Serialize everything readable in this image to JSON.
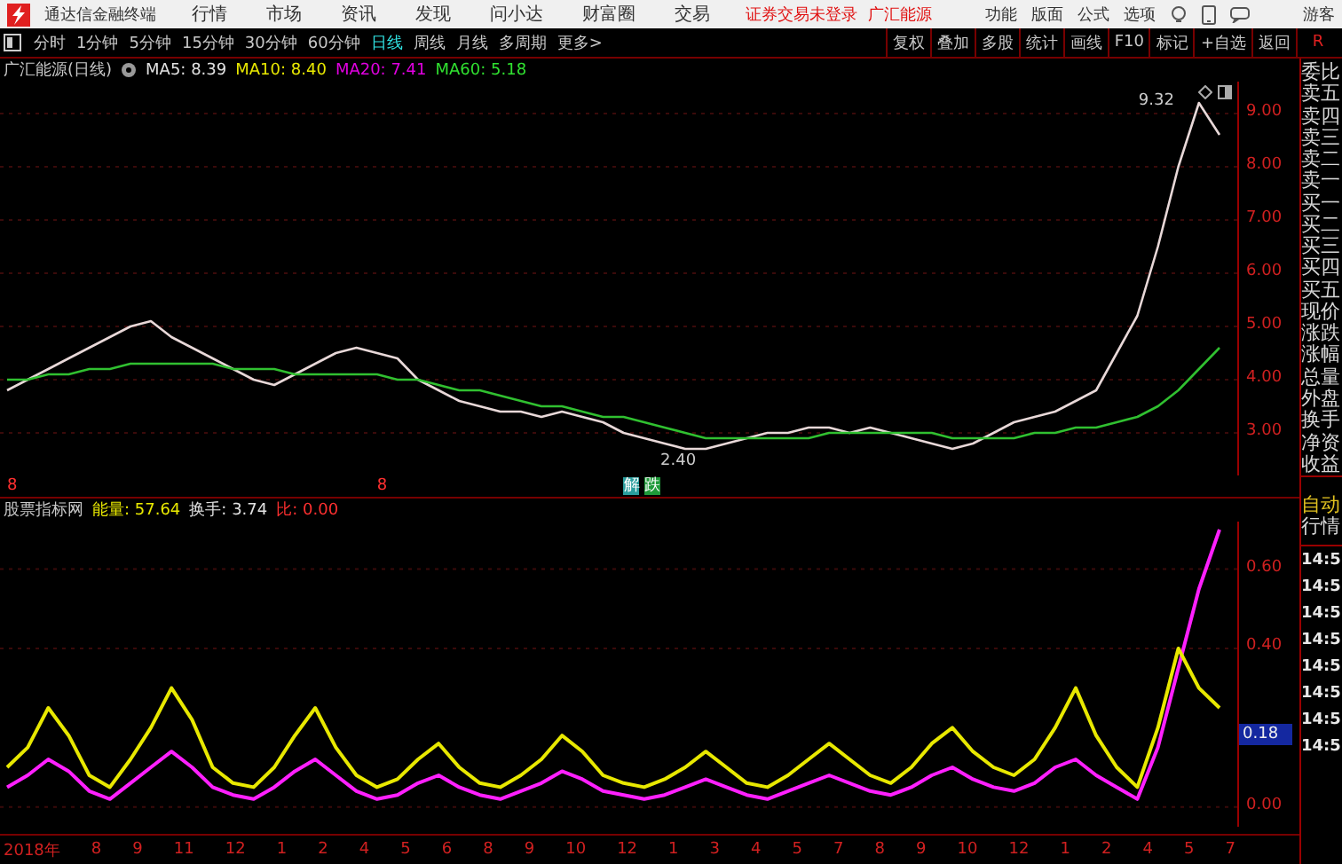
{
  "app": {
    "name": "通达信金融终端",
    "menu": [
      "行情",
      "市场",
      "资讯",
      "发现",
      "问小达",
      "财富圈",
      "交易"
    ],
    "login_notice": "证券交易未登录",
    "stock_link": "广汇能源",
    "tools": [
      "功能",
      "版面",
      "公式",
      "选项"
    ],
    "user": "游客"
  },
  "periods": [
    {
      "label": "分时",
      "selected": false
    },
    {
      "label": "1分钟",
      "selected": false
    },
    {
      "label": "5分钟",
      "selected": false
    },
    {
      "label": "15分钟",
      "selected": false
    },
    {
      "label": "30分钟",
      "selected": false
    },
    {
      "label": "60分钟",
      "selected": false
    },
    {
      "label": "日线",
      "selected": true
    },
    {
      "label": "周线",
      "selected": false
    },
    {
      "label": "月线",
      "selected": false
    },
    {
      "label": "多周期",
      "selected": false
    },
    {
      "label": "更多>",
      "selected": false
    }
  ],
  "chart_buttons": [
    "复权",
    "叠加",
    "多股",
    "统计",
    "画线",
    "F10",
    "标记",
    "+自选",
    "返回"
  ],
  "panel_toggle": "R",
  "price_header": {
    "title": "广汇能源(日线)",
    "ma": [
      {
        "label": "MA5: 8.39",
        "color": "#e0e0e0"
      },
      {
        "label": "MA10: 8.40",
        "color": "#e8e800"
      },
      {
        "label": "MA20: 7.41",
        "color": "#e000e0"
      },
      {
        "label": "MA60: 5.18",
        "color": "#30e030"
      }
    ]
  },
  "price_chart": {
    "chart_data": {
      "type": "line",
      "grid": true,
      "ylim": [
        2.2,
        9.6
      ],
      "yticks": [
        {
          "value": 3,
          "label": "3.00"
        },
        {
          "value": 4,
          "label": "4.00"
        },
        {
          "value": 5,
          "label": "5.00"
        },
        {
          "value": 6,
          "label": "6.00"
        },
        {
          "value": 7,
          "label": "7.00"
        },
        {
          "value": 8,
          "label": "8.00"
        },
        {
          "value": 9,
          "label": "9.00"
        }
      ],
      "series": [
        {
          "color": "#e8d8d8",
          "values": [
            3.8,
            4.0,
            4.2,
            4.4,
            4.6,
            4.8,
            5.0,
            5.1,
            4.8,
            4.6,
            4.4,
            4.2,
            4.0,
            3.9,
            4.1,
            4.3,
            4.5,
            4.6,
            4.5,
            4.4,
            4.0,
            3.8,
            3.6,
            3.5,
            3.4,
            3.4,
            3.3,
            3.4,
            3.3,
            3.2,
            3.0,
            2.9,
            2.8,
            2.7,
            2.7,
            2.8,
            2.9,
            3.0,
            3.0,
            3.1,
            3.1,
            3.0,
            3.1,
            3.0,
            2.9,
            2.8,
            2.7,
            2.8,
            3.0,
            3.2,
            3.3,
            3.4,
            3.6,
            3.8,
            4.5,
            5.2,
            6.5,
            8.0,
            9.2,
            8.6
          ]
        },
        {
          "color": "#30c030",
          "values": [
            4.0,
            4.0,
            4.1,
            4.1,
            4.2,
            4.2,
            4.3,
            4.3,
            4.3,
            4.3,
            4.3,
            4.2,
            4.2,
            4.2,
            4.1,
            4.1,
            4.1,
            4.1,
            4.1,
            4.0,
            4.0,
            3.9,
            3.8,
            3.8,
            3.7,
            3.6,
            3.5,
            3.5,
            3.4,
            3.3,
            3.3,
            3.2,
            3.1,
            3.0,
            2.9,
            2.9,
            2.9,
            2.9,
            2.9,
            2.9,
            3.0,
            3.0,
            3.0,
            3.0,
            3.0,
            3.0,
            2.9,
            2.9,
            2.9,
            2.9,
            3.0,
            3.0,
            3.1,
            3.1,
            3.2,
            3.3,
            3.5,
            3.8,
            4.2,
            4.6
          ]
        }
      ]
    }
  },
  "extreme_labels": {
    "high": "9.32",
    "low": "2.40"
  },
  "event_marks": [
    {
      "text": "8",
      "color": "#ff3030"
    },
    {
      "text": "8",
      "color": "#ff3030"
    },
    {
      "text": "解",
      "color": "#2a9d9d"
    },
    {
      "text": "跌",
      "color": "#1f9a3a"
    }
  ],
  "indicator": {
    "title": "股票指标网",
    "values": [
      {
        "label": "能量: 57.64",
        "color": "#e8e800"
      },
      {
        "label": "换手: 3.74",
        "color": "#e0e0e0"
      },
      {
        "label": "比: 0.00",
        "color": "#ff3030"
      }
    ],
    "current": "0.18",
    "chart_data": {
      "type": "line",
      "grid": true,
      "ylim": [
        -0.05,
        0.72
      ],
      "yticks": [
        {
          "value": 0,
          "label": "0.00"
        },
        {
          "value": 0.4,
          "label": "0.40"
        },
        {
          "value": 0.6,
          "label": "0.60"
        }
      ],
      "series": [
        {
          "color": "#ff20ff",
          "values": [
            0.05,
            0.08,
            0.12,
            0.09,
            0.04,
            0.02,
            0.06,
            0.1,
            0.14,
            0.1,
            0.05,
            0.03,
            0.02,
            0.05,
            0.09,
            0.12,
            0.08,
            0.04,
            0.02,
            0.03,
            0.06,
            0.08,
            0.05,
            0.03,
            0.02,
            0.04,
            0.06,
            0.09,
            0.07,
            0.04,
            0.03,
            0.02,
            0.03,
            0.05,
            0.07,
            0.05,
            0.03,
            0.02,
            0.04,
            0.06,
            0.08,
            0.06,
            0.04,
            0.03,
            0.05,
            0.08,
            0.1,
            0.07,
            0.05,
            0.04,
            0.06,
            0.1,
            0.12,
            0.08,
            0.05,
            0.02,
            0.15,
            0.35,
            0.55,
            0.7
          ]
        },
        {
          "color": "#e8e800",
          "values": [
            0.1,
            0.15,
            0.25,
            0.18,
            0.08,
            0.05,
            0.12,
            0.2,
            0.3,
            0.22,
            0.1,
            0.06,
            0.05,
            0.1,
            0.18,
            0.25,
            0.15,
            0.08,
            0.05,
            0.07,
            0.12,
            0.16,
            0.1,
            0.06,
            0.05,
            0.08,
            0.12,
            0.18,
            0.14,
            0.08,
            0.06,
            0.05,
            0.07,
            0.1,
            0.14,
            0.1,
            0.06,
            0.05,
            0.08,
            0.12,
            0.16,
            0.12,
            0.08,
            0.06,
            0.1,
            0.16,
            0.2,
            0.14,
            0.1,
            0.08,
            0.12,
            0.2,
            0.3,
            0.18,
            0.1,
            0.05,
            0.2,
            0.4,
            0.3,
            0.25
          ]
        }
      ]
    }
  },
  "x_axis": [
    "2018年",
    "8",
    "9",
    "11",
    "12",
    "1",
    "2",
    "4",
    "5",
    "6",
    "8",
    "9",
    "10",
    "12",
    "1",
    "3",
    "4",
    "5",
    "7",
    "8",
    "9",
    "10",
    "12",
    "1",
    "2",
    "4",
    "5",
    "7"
  ],
  "quote_panel": {
    "fields": [
      "委比",
      "卖五",
      "卖四",
      "卖三",
      "卖二",
      "卖一",
      "买一",
      "买二",
      "买三",
      "买四",
      "买五",
      "现价",
      "涨跌",
      "涨幅",
      "总量",
      "外盘",
      "换手",
      "净资",
      "收益"
    ],
    "mode": [
      "自动",
      "行情"
    ],
    "ticks": [
      "14:5",
      "14:5",
      "14:5",
      "14:5",
      "14:5",
      "14:5",
      "14:5",
      "14:5"
    ]
  }
}
